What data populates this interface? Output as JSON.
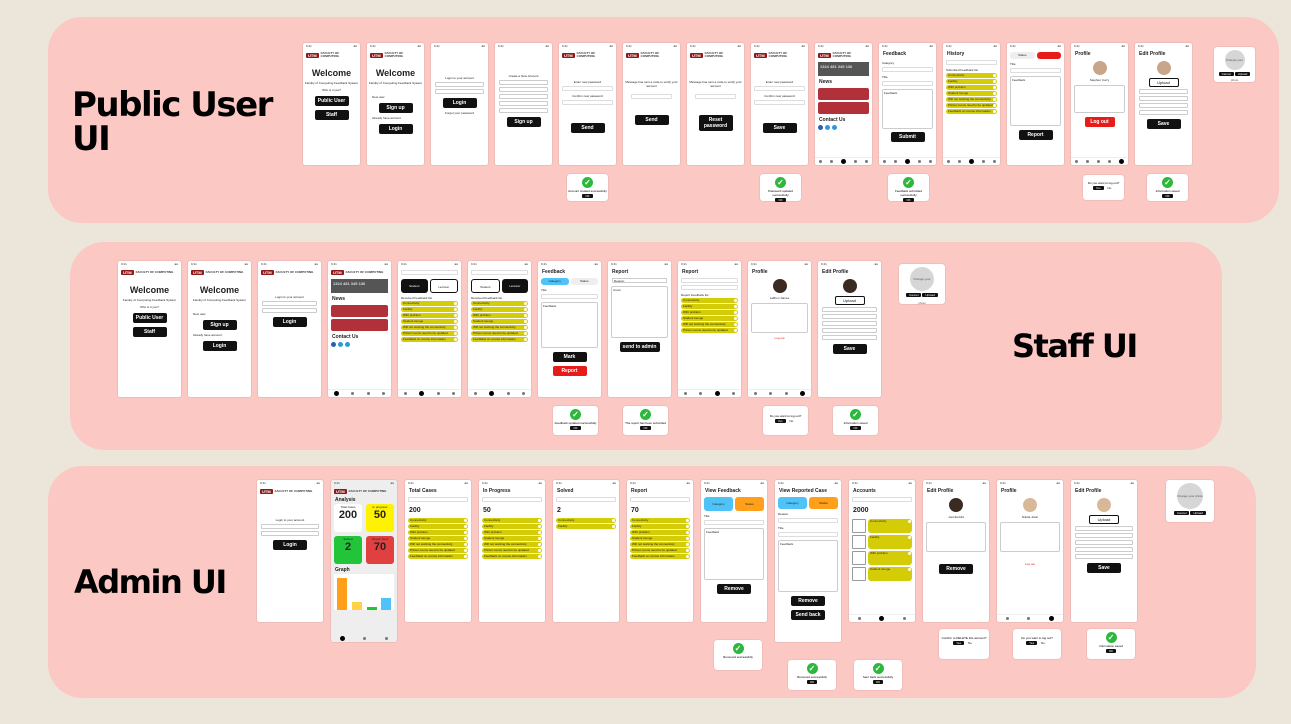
{
  "sections": {
    "public": "Public User UI",
    "staff": "Staff UI",
    "admin": "Admin UI"
  },
  "common": {
    "brand": "UTM",
    "faculty": "FACULTY OF COMPUTING",
    "welcome": "Welcome",
    "system_name": "Faculty of Computing Feedback System",
    "who": "Who is it you?",
    "public_user": "Public User",
    "staff": "Staff",
    "new_user": "New user",
    "sign_up": "Sign up",
    "already": "Already have account",
    "login": "Login",
    "login_to": "Login to your account",
    "create": "Create a New Account",
    "feedback": "Feedback",
    "history": "History",
    "report": "Report",
    "profile": "Profile",
    "edit_profile": "Edit Profile",
    "submit": "Submit",
    "save": "Save",
    "remove": "Remove",
    "send_back": "Send back",
    "send_to_admin": "send to admin",
    "news": "News",
    "contact": "Contact Us",
    "category": "Category",
    "status": "Status",
    "title": "Title",
    "reason": "Reason",
    "cover": "Cover",
    "student": "Student",
    "lecturer": "Lecturer",
    "submitted": "Submitted Feedback list",
    "received": "Received Feedback list",
    "report_list": "Report Feedback list",
    "logout": "Log out",
    "do_logout": "Do you want to log out?",
    "yes": "Yes",
    "no": "No",
    "change_photo": "Change your photo",
    "cancel": "Cancel",
    "upload": "Upload",
    "stats": "1324 481 345 136"
  },
  "public": {
    "forgot": "Forgot your password",
    "confirm": "Confirm new password",
    "sent": "Message has sent a code to verify your account",
    "send": "Send",
    "reset": "Reset password",
    "enter": "Enter new password",
    "user": "Stephen Curry",
    "ok1": "Account created successfully",
    "ok2": "Password updated successfully",
    "ok3": "Feedback submitted successfully",
    "ok4": "Information saved"
  },
  "staff": {
    "user": "LeBron James",
    "ok1": "Feedback updated successfully",
    "ok2": "The report has been submitted",
    "ok3": "Information saved"
  },
  "admin": {
    "analysis": "Analysis",
    "total": "Total cases",
    "progress": "In progress",
    "solved": "Solved",
    "report": "Report feed",
    "n_total": "200",
    "n_progress": "50",
    "n_solved": "2",
    "n_report": "70",
    "graph": "Graph",
    "total_cases": "Total Cases",
    "in_progress": "In Progress",
    "solved_t": "Solved",
    "view_feedback": "View Feedback",
    "view_reported": "View Reported Case",
    "accounts": "Accounts",
    "n_accounts": "2000",
    "user1": "Joel Embiid",
    "user2": "Nikola Jokic",
    "confirm_del": "Confirm to DELETE this account?",
    "ok1": "Removed successfully",
    "ok2": "Removed successfully",
    "ok3": "Sent back successfully",
    "ok4": "Information saved"
  },
  "chip_labels": [
    "Connectivity",
    "Facility",
    "WiFi problem",
    "Student lounge",
    "Wifi not working the connectivity",
    "Printer rooms need to be updated",
    "Feedback on course information"
  ],
  "colors": {
    "band": "#fcc8c4",
    "chip": "#d4cc06",
    "dark": "#111111",
    "red": "#e81b1b",
    "yellow": "#fff200",
    "green": "#2db83d",
    "blue": "#4fc3f7",
    "orange": "#ff9f1a"
  }
}
